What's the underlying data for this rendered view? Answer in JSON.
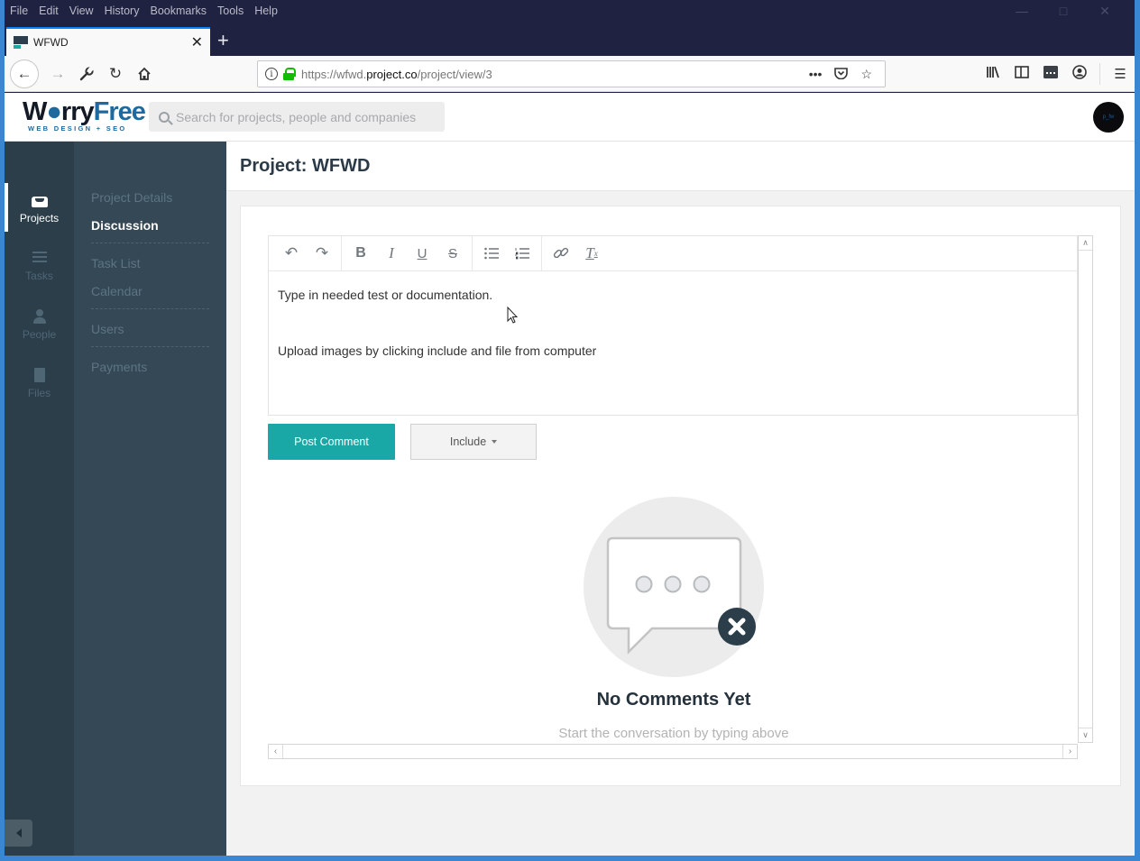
{
  "browser": {
    "menu": [
      "File",
      "Edit",
      "View",
      "History",
      "Bookmarks",
      "Tools",
      "Help"
    ],
    "tab": {
      "title": "WFWD",
      "favicon": "wfwd-favicon"
    },
    "url": {
      "prefix": "https://wfwd.",
      "domain": "project.co",
      "path": "/project/view/3"
    },
    "nav_icons": [
      "back-icon",
      "forward-icon",
      "wrench-icon",
      "reload-icon",
      "home-icon"
    ],
    "toolbar_icons": [
      "library-icon",
      "sidebar-icon",
      "extension-icon",
      "account-icon",
      "menu-icon"
    ]
  },
  "app": {
    "logo": {
      "word1": "W",
      "word1b": "rry",
      "word2": "Free",
      "tagline": "WEB DESIGN + SEO"
    },
    "search": {
      "placeholder": "Search for projects, people and companies"
    },
    "rail": [
      {
        "label": "Projects",
        "icon": "inbox-icon",
        "active": true
      },
      {
        "label": "Tasks",
        "icon": "list-icon",
        "active": false
      },
      {
        "label": "People",
        "icon": "user-icon",
        "active": false
      },
      {
        "label": "Files",
        "icon": "file-icon",
        "active": false
      }
    ],
    "subnav": [
      {
        "label": "Project Details",
        "active": false
      },
      {
        "label": "Discussion",
        "active": true
      },
      {
        "label": "Task List",
        "active": false
      },
      {
        "label": "Calendar",
        "active": false
      },
      {
        "label": "Users",
        "active": false
      },
      {
        "label": "Payments",
        "active": false
      }
    ],
    "page_title": "Project: WFWD",
    "editor": {
      "toolbar": [
        "undo",
        "redo",
        "bold",
        "italic",
        "underline",
        "strikethrough",
        "bulleted-list",
        "numbered-list",
        "link",
        "clear-formatting"
      ],
      "lines": [
        "Type in needed test or documentation.",
        "Upload images by clicking include and file from computer"
      ]
    },
    "buttons": {
      "post": "Post Comment",
      "include": "Include"
    },
    "empty": {
      "title": "No Comments Yet",
      "subtitle": "Start the conversation by typing above"
    },
    "colors": {
      "accent": "#1aa8a6",
      "sidebar": "#344855",
      "rail": "#2b3e4a"
    }
  }
}
